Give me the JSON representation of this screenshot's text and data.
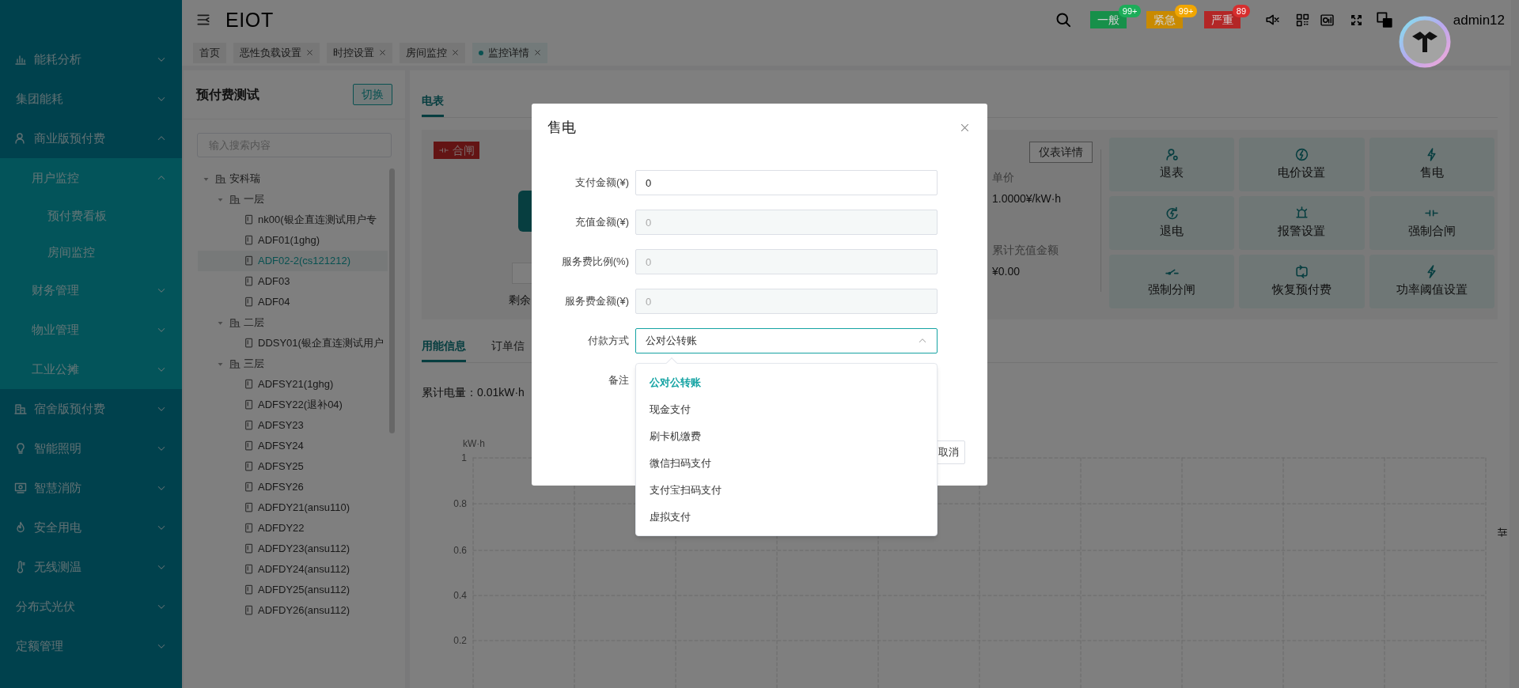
{
  "header": {
    "title": "EIOT",
    "alerts": [
      {
        "label": "一般",
        "count": "99+",
        "color": "#17904a"
      },
      {
        "label": "紧急",
        "count": "99+",
        "color": "#c98a00"
      },
      {
        "label": "严重",
        "count": "89",
        "color": "#b32626"
      }
    ],
    "user": "admin12"
  },
  "sidebar": {
    "items": [
      {
        "label": "能耗分析",
        "expanded": false
      },
      {
        "label": "集团能耗",
        "expanded": false
      },
      {
        "label": "商业版预付费",
        "expanded": true,
        "children": [
          {
            "label": "用户监控",
            "expanded": true,
            "children": [
              {
                "label": "预付费看板"
              },
              {
                "label": "房间监控"
              }
            ]
          },
          {
            "label": "财务管理",
            "expanded": false
          },
          {
            "label": "物业管理",
            "expanded": false
          },
          {
            "label": "工业公摊",
            "expanded": false
          }
        ]
      },
      {
        "label": "宿舍版预付费",
        "expanded": false
      },
      {
        "label": "智能照明",
        "expanded": false
      },
      {
        "label": "智慧消防",
        "expanded": false
      },
      {
        "label": "安全用电",
        "expanded": false
      },
      {
        "label": "无线测温",
        "expanded": false
      },
      {
        "label": "分布式光伏",
        "expanded": false
      },
      {
        "label": "定额管理",
        "expanded": false
      }
    ]
  },
  "tabs": [
    {
      "label": "首页",
      "closable": false,
      "selected": false
    },
    {
      "label": "恶性负载设置",
      "closable": true,
      "selected": false
    },
    {
      "label": "时控设置",
      "closable": true,
      "selected": false
    },
    {
      "label": "房间监控",
      "closable": true,
      "selected": false
    },
    {
      "label": "监控详情",
      "closable": true,
      "selected": true
    }
  ],
  "tree_panel": {
    "title": "预付费测试",
    "switch_button": "切换",
    "search_placeholder": "输入搜索内容",
    "tree": [
      {
        "label": "安科瑞",
        "kind": "group",
        "expanded": true,
        "selected": false,
        "children": [
          {
            "label": "一层",
            "kind": "group",
            "expanded": true,
            "selected": false,
            "children": [
              {
                "label": "nk00(银企直连测试用户专",
                "kind": "meter",
                "selected": false
              },
              {
                "label": "ADF01(1ghg)",
                "kind": "meter",
                "selected": false
              },
              {
                "label": "ADF02-2(cs121212)",
                "kind": "meter",
                "selected": true
              },
              {
                "label": "ADF03",
                "kind": "meter",
                "selected": false
              },
              {
                "label": "ADF04",
                "kind": "meter",
                "selected": false
              }
            ]
          },
          {
            "label": "二层",
            "kind": "group",
            "expanded": true,
            "selected": false,
            "children": [
              {
                "label": "DDSY01(银企直连测试用户",
                "kind": "meter",
                "selected": false
              }
            ]
          },
          {
            "label": "三层",
            "kind": "group",
            "expanded": true,
            "selected": false,
            "children": [
              {
                "label": "ADFSY21(1ghg)",
                "kind": "meter",
                "selected": false
              },
              {
                "label": "ADFSY22(退补04)",
                "kind": "meter",
                "selected": false
              },
              {
                "label": "ADFSY23",
                "kind": "meter",
                "selected": false
              },
              {
                "label": "ADFSY24",
                "kind": "meter",
                "selected": false
              },
              {
                "label": "ADFSY25",
                "kind": "meter",
                "selected": false
              },
              {
                "label": "ADFSY26",
                "kind": "meter",
                "selected": false
              },
              {
                "label": "ADFDY21(ansu110)",
                "kind": "meter",
                "selected": false
              },
              {
                "label": "ADFDY22",
                "kind": "meter",
                "selected": false
              },
              {
                "label": "ADFDY23(ansu112)",
                "kind": "meter",
                "selected": false
              },
              {
                "label": "ADFDY24(ansu112)",
                "kind": "meter",
                "selected": false
              },
              {
                "label": "ADFDY25(ansu112)",
                "kind": "meter",
                "selected": false
              },
              {
                "label": "ADFDY26(ansu112)",
                "kind": "meter",
                "selected": false
              }
            ]
          }
        ]
      }
    ]
  },
  "meter_tabs": [
    {
      "label": "电表",
      "selected": true
    }
  ],
  "meter_card": {
    "status_badge": "合闸",
    "balance_label": "剩余",
    "detail_button": "仪表详情",
    "unit_price_label": "单价",
    "unit_price": "1.0000¥/kW·h",
    "total_recharge_label": "累计充值金额",
    "total_recharge": "¥0.00"
  },
  "actions": [
    "退表",
    "电价设置",
    "售电",
    "退电",
    "报警设置",
    "强制合闸",
    "强制分闸",
    "恢复预付费",
    "功率阈值设置"
  ],
  "info_tabs": [
    {
      "label": "用能信息",
      "selected": true
    },
    {
      "label": "订单信",
      "selected": false
    }
  ],
  "total_energy": "累计电量：0.01kW·h",
  "usage_chart": {
    "unit": "kW·h",
    "y_ticks": [
      "1",
      "0.8",
      "0.6",
      "0.4",
      "0.2"
    ]
  },
  "dialog": {
    "title": "售电",
    "fields": [
      {
        "label": "支付金额(¥)",
        "value": "0",
        "disabled": false
      },
      {
        "label": "充值金额(¥)",
        "value": "0",
        "disabled": true
      },
      {
        "label": "服务费比例(%)",
        "value": "0",
        "disabled": true
      },
      {
        "label": "服务费金额(¥)",
        "value": "0",
        "disabled": true
      }
    ],
    "payment": {
      "label": "付款方式",
      "value": "公对公转账",
      "expanded": true,
      "options": [
        {
          "label": "公对公转账",
          "selected": true
        },
        {
          "label": "现金支付",
          "selected": false
        },
        {
          "label": "刷卡机缴费",
          "selected": false
        },
        {
          "label": "微信扫码支付",
          "selected": false
        },
        {
          "label": "支付宝扫码支付",
          "selected": false
        },
        {
          "label": "虚拟支付",
          "selected": false
        }
      ]
    },
    "remark_label": "备注",
    "cancel_button": "取消"
  }
}
